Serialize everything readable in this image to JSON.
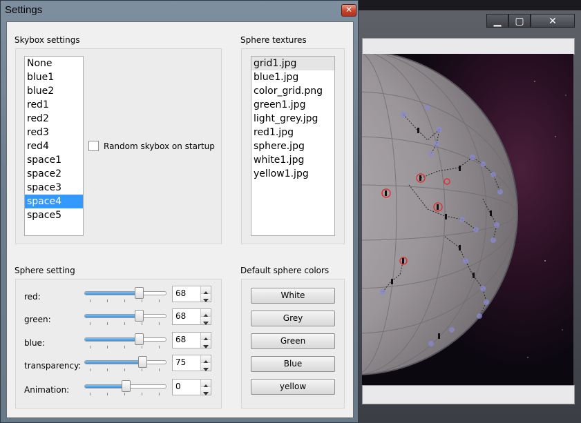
{
  "settings_window": {
    "title": "Settings",
    "close_glyph": "✕"
  },
  "skybox": {
    "title": "Skybox settings",
    "items": [
      "None",
      "blue1",
      "blue2",
      "red1",
      "red2",
      "red3",
      "red4",
      "space1",
      "space2",
      "space3",
      "space4",
      "space5"
    ],
    "selected": "space4",
    "random_label": "Random skybox on startup",
    "random_checked": false
  },
  "textures": {
    "title": "Sphere textures",
    "items": [
      "grid1.jpg",
      "blue1.jpg",
      "color_grid.png",
      "green1.jpg",
      "light_grey.jpg",
      "red1.jpg",
      "sphere.jpg",
      "white1.jpg",
      "yellow1.jpg"
    ],
    "current": "grid1.jpg"
  },
  "sphere_setting": {
    "title": "Sphere setting",
    "rows": [
      {
        "label": "red:",
        "value": "68",
        "fraction": 0.66
      },
      {
        "label": "green:",
        "value": "68",
        "fraction": 0.66
      },
      {
        "label": "blue:",
        "value": "68",
        "fraction": 0.66
      },
      {
        "label": "transparency:",
        "value": "75",
        "fraction": 0.71
      },
      {
        "label": "Animation:",
        "value": "0",
        "fraction": 0.5
      }
    ]
  },
  "default_colors": {
    "title": "Default sphere colors",
    "buttons": [
      "White",
      "Grey",
      "Green",
      "Blue",
      "yellow"
    ]
  },
  "viewer_window": {
    "minimize_glyph": "▁",
    "maximize_glyph": "▢",
    "close_glyph": "✕"
  },
  "colors": {
    "selection": "#3399ff",
    "slider_fill": "#3c8fdc",
    "close_red": "#c7412a"
  },
  "icons": [
    "close-icon",
    "minimize-icon",
    "maximize-icon",
    "spin-up-arrow-icon",
    "spin-down-arrow-icon"
  ]
}
